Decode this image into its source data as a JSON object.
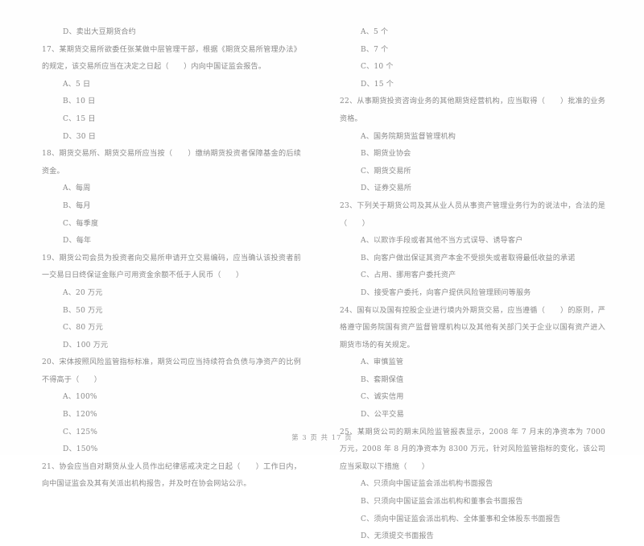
{
  "document": {
    "type": "exam-paper",
    "footer": "第 3 页  共 17 页",
    "text_color": "#8a8a8a",
    "background_color": "#ffffff"
  },
  "left_column": {
    "blocks": [
      {
        "kind": "option",
        "text": "D、卖出大豆期货合约"
      },
      {
        "kind": "stem",
        "text": "17、某期货交易所欲委任张某做中层管理干部，根据《期货交易所管理办法》的规定，该交易所应当在决定之日起（      ）内向中国证监会报告。"
      },
      {
        "kind": "option",
        "text": "A、5 日"
      },
      {
        "kind": "option",
        "text": "B、10 日"
      },
      {
        "kind": "option",
        "text": "C、15 日"
      },
      {
        "kind": "option",
        "text": "D、30 日"
      },
      {
        "kind": "stem",
        "text": "18、期货交易所、期货交易所应当按（      ）缴纳期货投资者保障基金的后续资金。"
      },
      {
        "kind": "option",
        "text": "A、每周"
      },
      {
        "kind": "option",
        "text": "B、每月"
      },
      {
        "kind": "option",
        "text": "C、每季度"
      },
      {
        "kind": "option",
        "text": "D、每年"
      },
      {
        "kind": "stem",
        "text": "19、期货公司会员为投资者向交易所申请开立交易编码，应当确认该投资者前一交易日日终保证金账户可用资金余额不低于人民币（      ）"
      },
      {
        "kind": "option",
        "text": "A、20 万元"
      },
      {
        "kind": "option",
        "text": "B、50 万元"
      },
      {
        "kind": "option",
        "text": "C、80 万元"
      },
      {
        "kind": "option",
        "text": "D、100 万元"
      },
      {
        "kind": "stem",
        "text": "20、宋体按照风险监管指标标准，期货公司应当持续符合负债与净资产的比例不得高于（      ）"
      },
      {
        "kind": "option",
        "text": "A、100%"
      },
      {
        "kind": "option",
        "text": "B、120%"
      },
      {
        "kind": "option",
        "text": "C、125%"
      },
      {
        "kind": "option",
        "text": "D、150%"
      },
      {
        "kind": "stem",
        "text": "21、协会应当自对期货从业人员作出纪律惩戒决定之日起（      ）工作日内，向中国证监会及其有关派出机构报告，并及时在协会网站公示。"
      }
    ]
  },
  "right_column": {
    "blocks": [
      {
        "kind": "option",
        "text": "A、5 个"
      },
      {
        "kind": "option",
        "text": "B、7 个"
      },
      {
        "kind": "option",
        "text": "C、10 个"
      },
      {
        "kind": "option",
        "text": "D、15 个"
      },
      {
        "kind": "stem",
        "text": "22、从事期货投资咨询业务的其他期货经营机构，应当取得（      ）批准的业务资格。"
      },
      {
        "kind": "option",
        "text": "A、国务院期货监督管理机构"
      },
      {
        "kind": "option",
        "text": "B、期货业协会"
      },
      {
        "kind": "option",
        "text": "C、期货交易所"
      },
      {
        "kind": "option",
        "text": "D、证券交易所"
      },
      {
        "kind": "stem",
        "text": "23、下列关于期货公司及其从业人员从事资产管理业务行为的说法中，合法的是（      ）"
      },
      {
        "kind": "option",
        "text": "A、以欺诈手段或者其他不当方式误导、诱导客户"
      },
      {
        "kind": "option",
        "text": "B、向客户做出保证其资产本金不受损失或者取得最低收益的承诺"
      },
      {
        "kind": "option",
        "text": "C、占用、挪用客户委托资产"
      },
      {
        "kind": "option",
        "text": "D、接受客户委托，向客户提供风险管理顾问等服务"
      },
      {
        "kind": "stem",
        "text": "24、国有以及国有控股企业进行境内外期货交易，应当遵循（      ）的原则，严格遵守国务院国有资产监督管理机构以及其他有关部门关于企业以国有资产进入期货市场的有关规定。"
      },
      {
        "kind": "option",
        "text": "A、审慎监管"
      },
      {
        "kind": "option",
        "text": "B、套期保值"
      },
      {
        "kind": "option",
        "text": "C、诚实信用"
      },
      {
        "kind": "option",
        "text": "D、公平交易"
      },
      {
        "kind": "stem",
        "text": "25、某期货公司的期末风险监管报表显示，2008 年 7 月末的净资本为 7000 万元，2008 年 8 月的净资本为 8300 万元，针对风险监管指标的变化，该公司应当采取以下措施（      ）"
      },
      {
        "kind": "option",
        "text": "A、只须向中国证监会派出机构书面报告"
      },
      {
        "kind": "option",
        "text": "B、只须向中国证监会派出机构和董事会书面报告"
      },
      {
        "kind": "option",
        "text": "C、须向中国证监会派出机构、全体董事和全体股东书面报告"
      },
      {
        "kind": "option",
        "text": "D、无须提交书面报告"
      }
    ]
  }
}
